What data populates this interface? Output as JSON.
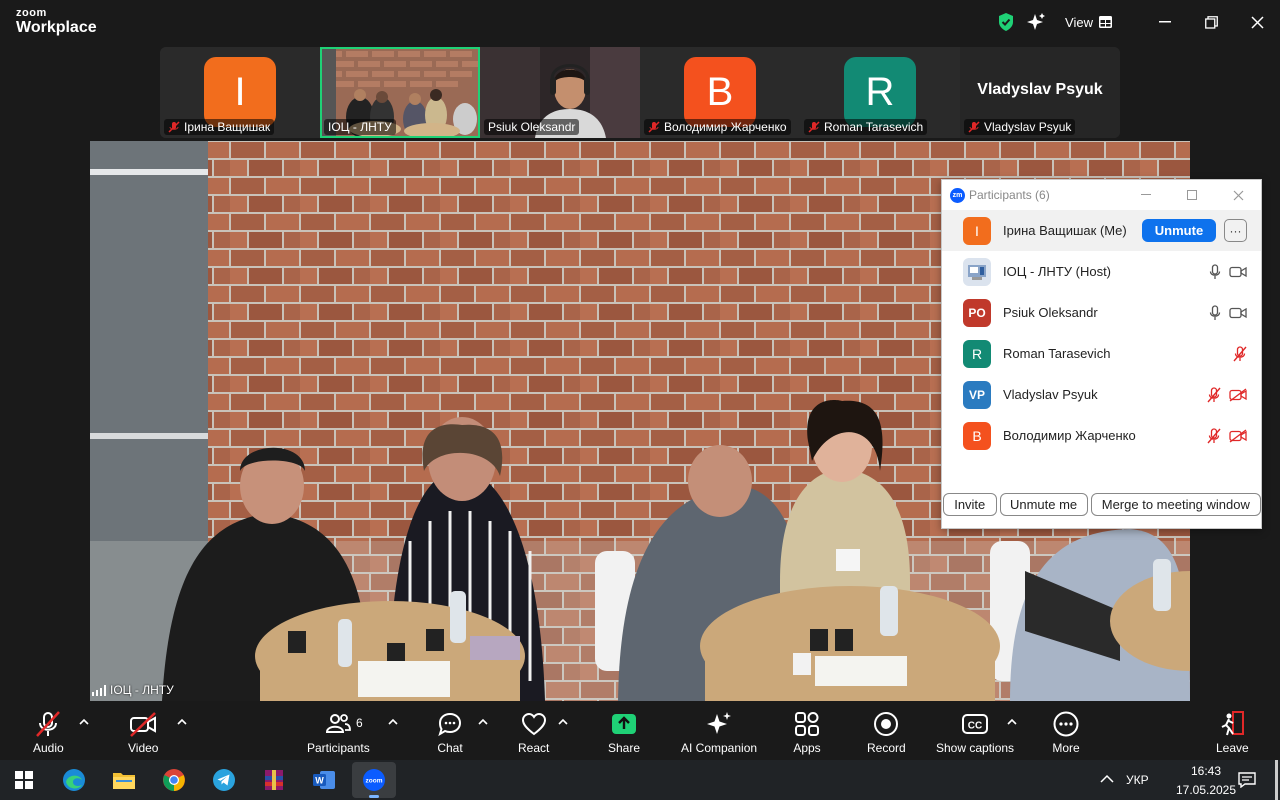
{
  "app": {
    "logo_line1": "zoom",
    "logo_line2": "Workplace",
    "view_label": "View"
  },
  "thumbnails": [
    {
      "name": "Ірина Ващишак",
      "initial": "I",
      "color": "#f26d1d",
      "muted": true,
      "type": "avatar"
    },
    {
      "name": "ІОЦ - ЛНТУ",
      "type": "video",
      "active": true,
      "muted": false
    },
    {
      "name": "Psiuk Oleksandr",
      "type": "video",
      "muted": false
    },
    {
      "name": "Володимир Жарченко",
      "initial": "B",
      "color": "#f4511e",
      "muted": true,
      "type": "avatar"
    },
    {
      "name": "Roman Tarasevich",
      "initial": "R",
      "color": "#128a74",
      "muted": true,
      "type": "avatar"
    },
    {
      "name": "Vladyslav Psyuk",
      "big_name": "Vladyslav Psyuk",
      "muted": true,
      "type": "name"
    }
  ],
  "main_video": {
    "speaker_label": "ІОЦ - ЛНТУ"
  },
  "participants_panel": {
    "title": "Participants (6)",
    "unmute_label": "Unmute",
    "more_label": "···",
    "rows": [
      {
        "name": "Ірина Ващишак (Me)",
        "initial": "I",
        "color": "#f26d1d",
        "me": true
      },
      {
        "name": "ІОЦ - ЛНТУ (Host)",
        "initial": "",
        "color": "#dbe3ee",
        "mic": "on",
        "video": "on"
      },
      {
        "name": "Psiuk Oleksandr",
        "initial": "PO",
        "color": "#c0392b",
        "mic": "on",
        "video": "on"
      },
      {
        "name": "Roman Tarasevich",
        "initial": "R",
        "color": "#128a74",
        "mic": "muted"
      },
      {
        "name": "Vladyslav Psyuk",
        "initial": "VP",
        "color": "#2b7bc0",
        "mic": "muted",
        "video": "off"
      },
      {
        "name": "Володимир Жарченко",
        "initial": "B",
        "color": "#f4511e",
        "mic": "muted",
        "video": "off"
      }
    ],
    "footer": {
      "invite": "Invite",
      "unmute_me": "Unmute me",
      "merge": "Merge to meeting window"
    }
  },
  "toolbar": {
    "audio": "Audio",
    "video": "Video",
    "participants": "Participants",
    "participants_count": "6",
    "chat": "Chat",
    "react": "React",
    "share": "Share",
    "ai_companion": "AI Companion",
    "apps": "Apps",
    "record": "Record",
    "captions": "Show captions",
    "more": "More",
    "leave": "Leave"
  },
  "taskbar": {
    "language": "УКР",
    "time": "16:43",
    "date": "17.05.2025",
    "apps": [
      "start-icon",
      "edge-icon",
      "file-explorer-icon",
      "chrome-icon",
      "telegram-icon",
      "winrar-icon",
      "word-icon",
      "zoom-icon"
    ]
  },
  "colors": {
    "accent_blue": "#0e72ed",
    "share_green": "#1fd176",
    "active_tile": "#1fd176"
  }
}
